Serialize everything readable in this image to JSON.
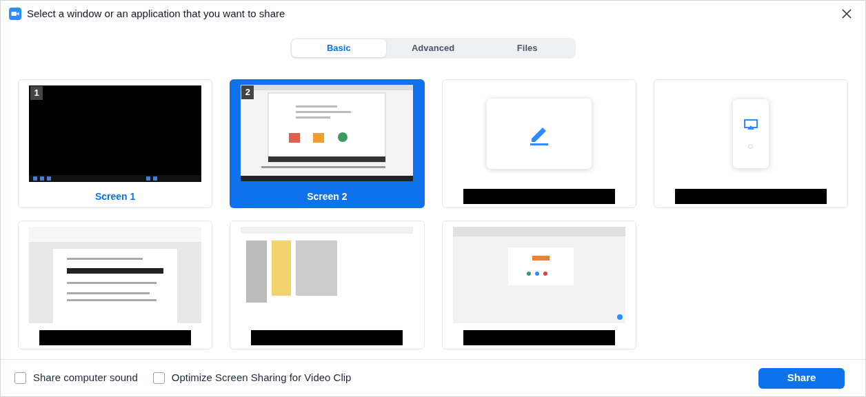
{
  "window": {
    "title": "Select a window or an application that you want to share"
  },
  "tabs": [
    {
      "label": "Basic",
      "selected": true
    },
    {
      "label": "Advanced",
      "selected": false
    },
    {
      "label": "Files",
      "selected": false
    }
  ],
  "sources": [
    {
      "kind": "screen",
      "number": "1",
      "label": "Screen 1",
      "selected": false
    },
    {
      "kind": "screen",
      "number": "2",
      "label": "Screen 2",
      "selected": true
    },
    {
      "kind": "whiteboard",
      "redacted": true,
      "selected": false
    },
    {
      "kind": "phone",
      "redacted": true,
      "selected": false
    },
    {
      "kind": "document",
      "redacted": true,
      "selected": false
    },
    {
      "kind": "explorer",
      "redacted": true,
      "selected": false
    },
    {
      "kind": "browser",
      "redacted": true,
      "selected": false
    }
  ],
  "options": [
    {
      "label": "Share computer sound",
      "checked": false
    },
    {
      "label": "Optimize Screen Sharing for Video Clip",
      "checked": false
    }
  ],
  "share_button": "Share"
}
